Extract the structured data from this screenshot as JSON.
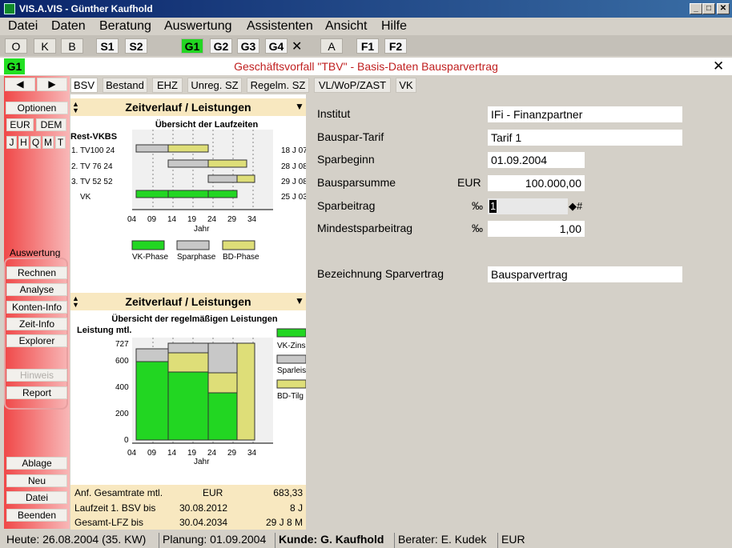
{
  "window": {
    "title": "VIS.A.VIS - Günther Kaufhold",
    "controls": [
      "_",
      "□",
      "✕"
    ]
  },
  "menu": [
    "Datei",
    "Daten",
    "Beratung",
    "Auswertung",
    "Assistenten",
    "Ansicht",
    "Hilfe"
  ],
  "toolbar": {
    "buttons": [
      "O",
      "K",
      "B",
      "S1",
      "S2",
      "G1",
      "G2",
      "G3",
      "G4",
      "✕",
      "A",
      "F1",
      "F2"
    ],
    "active": "G1"
  },
  "doc": {
    "tag": "G1",
    "caption": "Geschäftsvorfall \"TBV\" - Basis-Daten Bausparvertrag",
    "close": "✕"
  },
  "left": {
    "nav": [
      "◀",
      "▶"
    ],
    "options": "Optionen",
    "currency": [
      "EUR",
      "DEM"
    ],
    "periods": [
      "J",
      "H",
      "Q",
      "M",
      "T"
    ],
    "section": "Auswertung",
    "actions": [
      "Rechnen",
      "Analyse",
      "Konten-Info",
      "Zeit-Info",
      "Explorer"
    ],
    "hint": "Hinweis",
    "report": "Report",
    "bottom": [
      "Ablage",
      "Neu",
      "Datei",
      "Beenden"
    ]
  },
  "tabs": [
    "BSV",
    "Bestand",
    "EHZ",
    "Unreg. SZ",
    "Regelm. SZ",
    "VL/WoP/ZAST",
    "VK"
  ],
  "colors": {
    "vk": "#22d622",
    "spar": "#c8c8c8",
    "bd": "#dede78"
  },
  "chart1": {
    "header": "Zeitverlauf / Leistungen",
    "title": "Übersicht der Laufzeiten",
    "rowheader": "Rest-VKBS",
    "rows": [
      {
        "label": "1. TV100 24",
        "right": "18 J 07"
      },
      {
        "label": "2. TV   76 24",
        "right": "28 J 08"
      },
      {
        "label": "3. TV   52 52",
        "right": "29 J 08"
      },
      {
        "label": "VK",
        "right": "25 J 03"
      }
    ],
    "xticks": [
      "04",
      "09",
      "14",
      "19",
      "24",
      "29",
      "34"
    ],
    "xlabel": "Jahr",
    "legend": [
      "VK-Phase",
      "Sparphase",
      "BD-Phase"
    ]
  },
  "chart2": {
    "header": "Zeitverlauf / Leistungen",
    "title": "Übersicht der regelmäßigen Leistungen",
    "ylabel": "Leistung mtl.",
    "yticks": [
      "727",
      "600",
      "400",
      "200",
      "0"
    ],
    "xticks": [
      "04",
      "09",
      "14",
      "19",
      "24",
      "29",
      "34"
    ],
    "xlabel": "Jahr",
    "legend": [
      "VK-Zins",
      "Sparleis",
      "BD-Tilg"
    ]
  },
  "summary": [
    {
      "label": "Anf. Gesamtrate mtl.",
      "mid": "EUR",
      "value": "683,33"
    },
    {
      "label": "Laufzeit 1. BSV bis",
      "mid": "30.08.2012",
      "value": "8 J"
    },
    {
      "label": "Gesamt-LFZ bis",
      "mid": "30.04.2034",
      "value": "29 J 8 M"
    }
  ],
  "form": {
    "institut": {
      "label": "Institut",
      "value": "IFi - Finanzpartner"
    },
    "tarif": {
      "label": "Bauspar-Tarif",
      "value": "Tarif 1"
    },
    "sparbeginn": {
      "label": "Sparbeginn",
      "value": "01.09.2004"
    },
    "summe": {
      "label": "Bausparsumme",
      "unit": "EUR",
      "value": "100.000,00"
    },
    "sparbeitrag": {
      "label": "Sparbeitrag",
      "unit": "‰",
      "value": "1",
      "marker": "◆#"
    },
    "mindest": {
      "label": "Mindestsparbeitrag",
      "unit": "‰",
      "value": "1,00"
    },
    "bezeichnung": {
      "label": "Bezeichnung Sparvertrag",
      "value": "Bausparvertrag"
    }
  },
  "status": [
    "Heute: 26.08.2004 (35. KW)",
    "Planung: 01.09.2004",
    "Kunde: G. Kaufhold",
    "Berater: E. Kudek",
    "EUR"
  ]
}
